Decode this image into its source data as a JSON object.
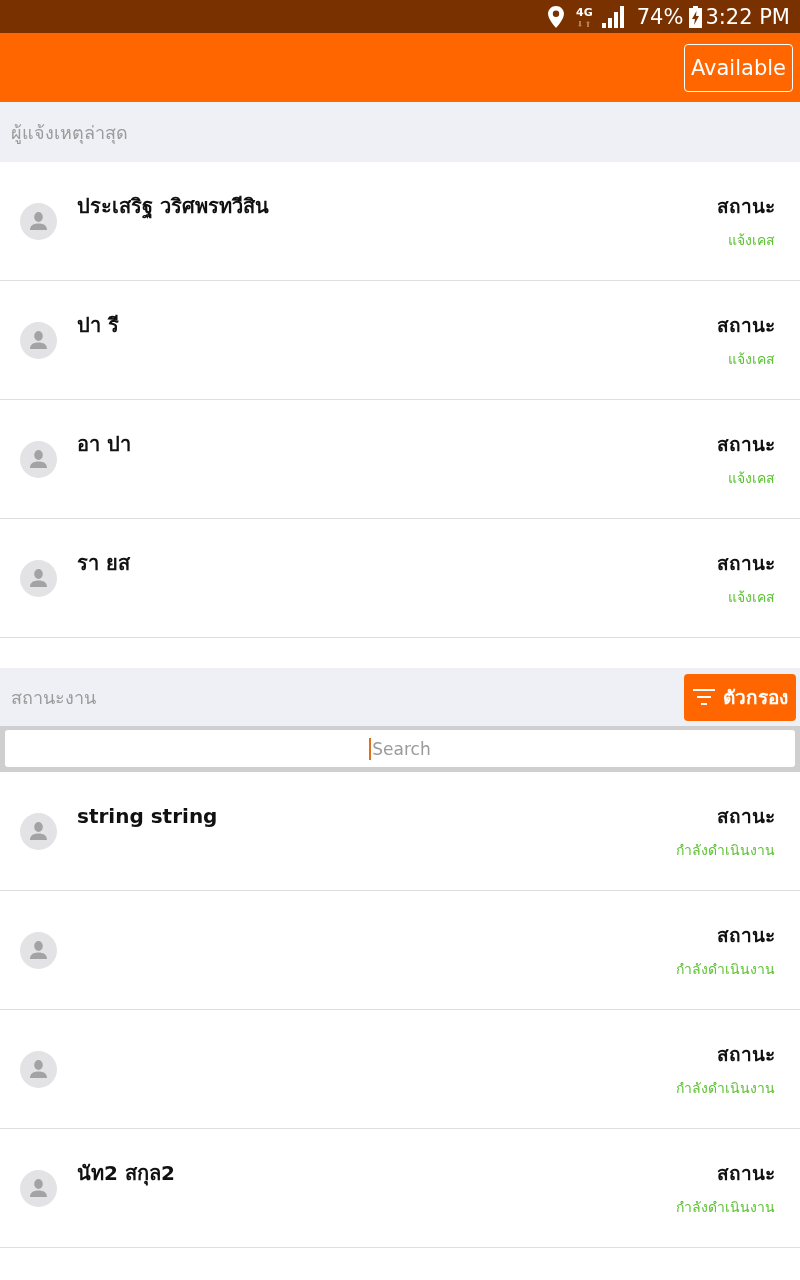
{
  "status_bar": {
    "network": "4G",
    "battery": "74%",
    "time": "3:22 PM"
  },
  "app_bar": {
    "button": "Available"
  },
  "reporters": {
    "title": "ผู้แจ้งเหตุล่าสุด",
    "rows": [
      {
        "name": "ประเสริฐ วริศพรทวีสิน",
        "status_label": "สถานะ",
        "status": "แจ้งเคส"
      },
      {
        "name": "ปา รี",
        "status_label": "สถานะ",
        "status": "แจ้งเคส"
      },
      {
        "name": "อา ปา",
        "status_label": "สถานะ",
        "status": "แจ้งเคส"
      },
      {
        "name": "รา ยส",
        "status_label": "สถานะ",
        "status": "แจ้งเคส"
      }
    ]
  },
  "jobs": {
    "title": "สถานะงาน",
    "filter_button": "ตัวกรอง",
    "search": {
      "placeholder": "Search",
      "focused": true
    },
    "rows": [
      {
        "name": "string string",
        "status_label": "สถานะ",
        "status": "กำลังดำเนินงาน"
      },
      {
        "status_label": "สถานะ",
        "status": "กำลังดำเนินงาน"
      },
      {
        "status_label": "สถานะ",
        "status": "กำลังดำเนินงาน"
      },
      {
        "name": "นัท2 สกุล2",
        "status_label": "สถานะ",
        "status": "กำลังดำเนินงาน"
      }
    ]
  }
}
